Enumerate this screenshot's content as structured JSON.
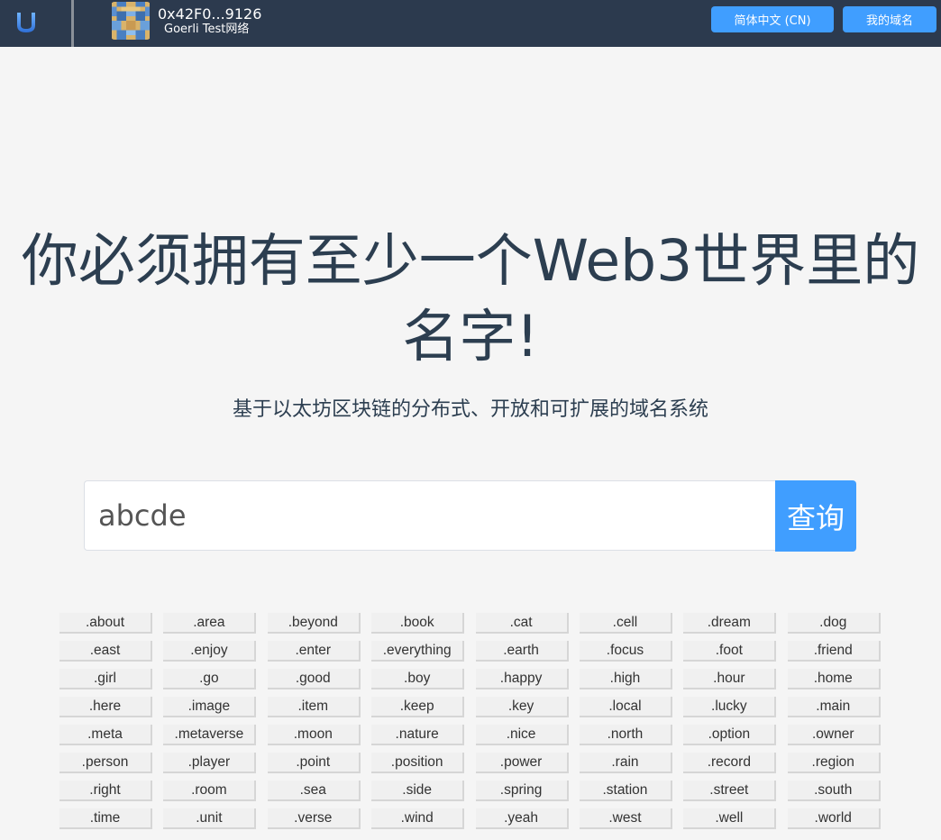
{
  "header": {
    "wallet_address": "0x42F0...9126",
    "network": "Goerli Test网络",
    "language_button": "简体中文 (CN)",
    "my_domains_button": "我的域名"
  },
  "hero": {
    "headline_line1": "你必须拥有至少一个Web3世界里的",
    "headline_line2": "名字!",
    "subtitle": "基于以太坊区块链的分布式、开放和可扩展的域名系统"
  },
  "search": {
    "value": "abcde",
    "button": "查询"
  },
  "suffixes": [
    ".about",
    ".area",
    ".beyond",
    ".book",
    ".cat",
    ".cell",
    ".dream",
    ".dog",
    ".east",
    ".enjoy",
    ".enter",
    ".everything",
    ".earth",
    ".focus",
    ".foot",
    ".friend",
    ".girl",
    ".go",
    ".good",
    ".boy",
    ".happy",
    ".high",
    ".hour",
    ".home",
    ".here",
    ".image",
    ".item",
    ".keep",
    ".key",
    ".local",
    ".lucky",
    ".main",
    ".meta",
    ".metaverse",
    ".moon",
    ".nature",
    ".nice",
    ".north",
    ".option",
    ".owner",
    ".person",
    ".player",
    ".point",
    ".position",
    ".power",
    ".rain",
    ".record",
    ".region",
    ".right",
    ".room",
    ".sea",
    ".side",
    ".spring",
    ".station",
    ".street",
    ".south",
    ".time",
    ".unit",
    ".verse",
    ".wind",
    ".yeah",
    ".west",
    ".well",
    ".world"
  ],
  "colors": {
    "topbar": "#2c3a4e",
    "accent": "#409eff",
    "text": "#2c3e50"
  }
}
